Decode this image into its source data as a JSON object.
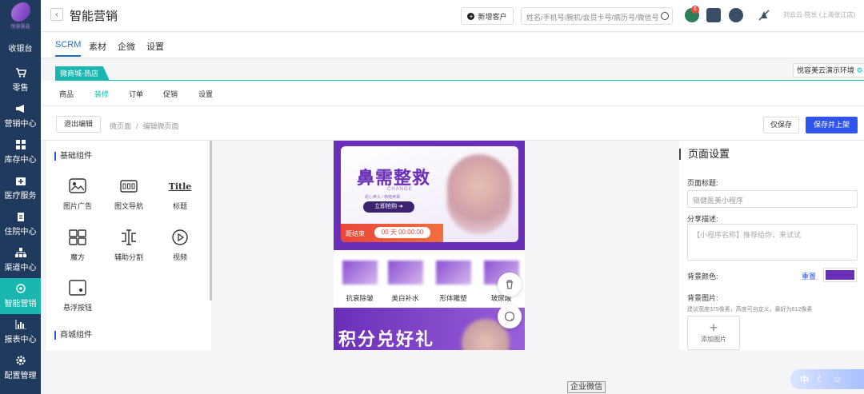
{
  "sidebar": {
    "logo_text": "悦容慧选",
    "items": [
      {
        "label": "收银台",
        "icon": "cashier-icon"
      },
      {
        "label": "零售",
        "icon": "cart-icon"
      },
      {
        "label": "营销中心",
        "icon": "megaphone-icon"
      },
      {
        "label": "库存中心",
        "icon": "grid-icon"
      },
      {
        "label": "医疗服务",
        "icon": "medical-kit-icon"
      },
      {
        "label": "住院中心",
        "icon": "clipboard-icon"
      },
      {
        "label": "渠道中心",
        "icon": "org-chart-icon"
      },
      {
        "label": "智能营销",
        "icon": "target-icon",
        "active": true
      },
      {
        "label": "报表中心",
        "icon": "bar-chart-icon"
      },
      {
        "label": "配置管理",
        "icon": "gear-icon"
      }
    ],
    "accent": "#19b7b0",
    "bg": "#1f3a5c"
  },
  "header": {
    "title": "智能营销",
    "new_customer": "新增客户",
    "search_placeholder": "姓名/手机号/腕机/会员卡号/病历号/微信号",
    "badge_count": "6",
    "user": "刘云云-院长 (上海张江店)"
  },
  "tabs_main": [
    {
      "label": "SCRM",
      "active": true
    },
    {
      "label": "素材"
    },
    {
      "label": "企微"
    },
    {
      "label": "设置"
    }
  ],
  "shop": {
    "tag": "微商城-热店",
    "env": "悦容美云演示环境"
  },
  "tabs_sub": [
    {
      "label": "商品"
    },
    {
      "label": "装修",
      "active": true
    },
    {
      "label": "订单"
    },
    {
      "label": "促销"
    },
    {
      "label": "设置"
    }
  ],
  "editbar": {
    "exit": "退出编辑",
    "crumb1": "微页面",
    "sep": "/",
    "crumb2": "编辑微页面",
    "save_only": "仅保存",
    "save_publish": "保存并上架"
  },
  "components": {
    "basic_title": "基础组件",
    "items": [
      {
        "label": "图片广告",
        "icon": "image-ad-icon"
      },
      {
        "label": "图文导航",
        "icon": "image-nav-icon"
      },
      {
        "label": "标题",
        "icon": "title-icon",
        "icon_text": "Title"
      },
      {
        "label": "魔方",
        "icon": "cube-grid-icon"
      },
      {
        "label": "辅助分割",
        "icon": "divider-icon"
      },
      {
        "label": "视频",
        "icon": "video-icon"
      },
      {
        "label": "悬浮按钮",
        "icon": "float-button-icon"
      }
    ],
    "mall_title": "商城组件"
  },
  "preview": {
    "banner_title": "鼻需整救",
    "banner_en": "CHANGE",
    "banner_sub": "甜心鼻头 / 精雕鼻翼",
    "buy_label": "立即抢购 ➜",
    "countdown_label": "距结束",
    "countdown": "00 天 00:00:00",
    "nav": [
      "抗衰除皱",
      "美白补水",
      "形体雕塑",
      "玻尿酸"
    ],
    "banner2_title": "积分兑好礼"
  },
  "settings": {
    "title": "页面设置",
    "page_title_label": "页面标题:",
    "page_title_value": "锁健医美小程序",
    "share_label": "分享描述:",
    "share_placeholder": "【小程序名称】推荐给你，来试试",
    "bg_color_label": "背景颜色:",
    "reset": "重置",
    "bg_color": "#6a2fb8",
    "bg_image_label": "背景图片:",
    "hint": "建议宽度375像素，高度可自定义，最好为612像素",
    "add_image": "添加图片"
  },
  "overlay": {
    "wechat": "企业微信",
    "ime": "中"
  }
}
